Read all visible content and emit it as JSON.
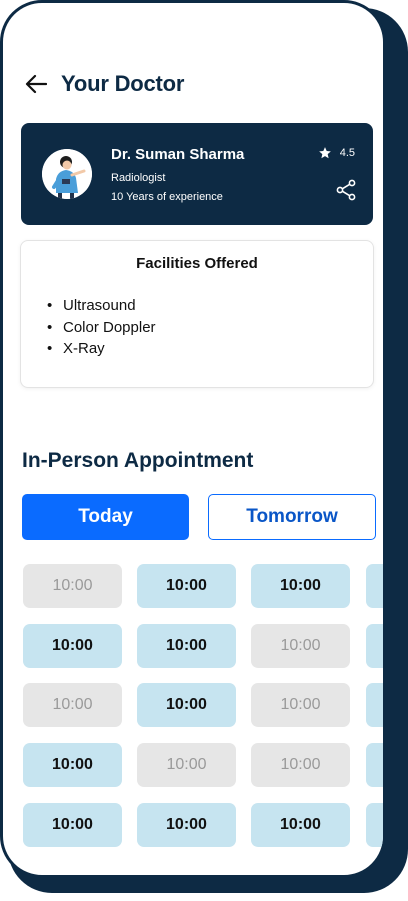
{
  "header": {
    "title": "Your Doctor"
  },
  "doctor": {
    "name": "Dr. Suman Sharma",
    "specialty": "Radiologist",
    "experience": "10 Years of experience",
    "rating": "4.5"
  },
  "facilities": {
    "title": "Facilities Offered",
    "items": [
      "Ultrasound",
      "Color Doppler",
      "X-Ray"
    ]
  },
  "appointment": {
    "title": "In-Person Appointment",
    "today_label": "Today",
    "tomorrow_label": "Tomorrow",
    "selected_day": "Today",
    "slots": [
      [
        {
          "time": "10:00",
          "available": false
        },
        {
          "time": "10:00",
          "available": true
        },
        {
          "time": "10:00",
          "available": true
        },
        {
          "time": "",
          "available": true
        }
      ],
      [
        {
          "time": "10:00",
          "available": true
        },
        {
          "time": "10:00",
          "available": true
        },
        {
          "time": "10:00",
          "available": false
        },
        {
          "time": "",
          "available": true
        }
      ],
      [
        {
          "time": "10:00",
          "available": false
        },
        {
          "time": "10:00",
          "available": true
        },
        {
          "time": "10:00",
          "available": false
        },
        {
          "time": "",
          "available": true
        }
      ],
      [
        {
          "time": "10:00",
          "available": true
        },
        {
          "time": "10:00",
          "available": false
        },
        {
          "time": "10:00",
          "available": false
        },
        {
          "time": "",
          "available": true
        }
      ],
      [
        {
          "time": "10:00",
          "available": true
        },
        {
          "time": "10:00",
          "available": true
        },
        {
          "time": "10:00",
          "available": true
        },
        {
          "time": "",
          "available": true
        }
      ]
    ]
  },
  "colors": {
    "navy": "#0d2a44",
    "primary": "#0a6bff",
    "slot_available": "#c6e4f0",
    "slot_unavailable": "#e6e6e6"
  },
  "icons": {
    "back": "arrow-left-icon",
    "star": "star-icon",
    "share": "share-icon",
    "avatar": "doctor-avatar-illustration"
  }
}
